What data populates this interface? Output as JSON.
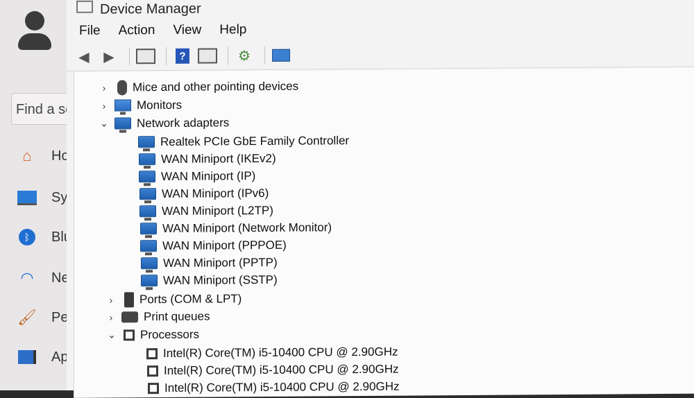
{
  "settings": {
    "search_placeholder": "Find a se",
    "nav": [
      {
        "label": "Ho",
        "icon": "home-icon"
      },
      {
        "label": "Sys",
        "icon": "system-icon"
      },
      {
        "label": "Blu",
        "icon": "bluetooth-icon"
      },
      {
        "label": "Ne",
        "icon": "wifi-icon"
      },
      {
        "label": "Per",
        "icon": "brush-icon"
      },
      {
        "label": "Ap",
        "icon": "apps-icon"
      }
    ]
  },
  "window": {
    "title": "Device Manager"
  },
  "menu": [
    "File",
    "Action",
    "View",
    "Help"
  ],
  "toolbar": [
    "back-icon",
    "forward-icon",
    "properties-icon",
    "help-icon",
    "view-icon",
    "update-driver-icon",
    "scan-hardware-icon"
  ],
  "tree": [
    {
      "label": "Mice and other pointing devices",
      "level": 0,
      "state": "collapsed",
      "icon": "mouse-icon"
    },
    {
      "label": "Monitors",
      "level": 0,
      "state": "collapsed",
      "icon": "monitor-icon"
    },
    {
      "label": "Network adapters",
      "level": 0,
      "state": "expanded",
      "icon": "network-adapter-icon"
    },
    {
      "label": "Realtek PCIe GbE Family Controller",
      "level": 1,
      "icon": "network-adapter-icon"
    },
    {
      "label": "WAN Miniport (IKEv2)",
      "level": 1,
      "icon": "network-adapter-icon"
    },
    {
      "label": "WAN Miniport (IP)",
      "level": 1,
      "icon": "network-adapter-icon"
    },
    {
      "label": "WAN Miniport (IPv6)",
      "level": 1,
      "icon": "network-adapter-icon"
    },
    {
      "label": "WAN Miniport (L2TP)",
      "level": 1,
      "icon": "network-adapter-icon"
    },
    {
      "label": "WAN Miniport (Network Monitor)",
      "level": 1,
      "icon": "network-adapter-icon"
    },
    {
      "label": "WAN Miniport (PPPOE)",
      "level": 1,
      "icon": "network-adapter-icon"
    },
    {
      "label": "WAN Miniport (PPTP)",
      "level": 1,
      "icon": "network-adapter-icon"
    },
    {
      "label": "WAN Miniport (SSTP)",
      "level": 1,
      "icon": "network-adapter-icon"
    },
    {
      "label": "Ports (COM & LPT)",
      "level": 0,
      "state": "collapsed",
      "icon": "port-icon"
    },
    {
      "label": "Print queues",
      "level": 0,
      "state": "collapsed",
      "icon": "printer-icon"
    },
    {
      "label": "Processors",
      "level": 0,
      "state": "expanded",
      "icon": "processor-icon"
    },
    {
      "label": "Intel(R) Core(TM) i5-10400 CPU @ 2.90GHz",
      "level": 1,
      "icon": "processor-icon"
    },
    {
      "label": "Intel(R) Core(TM) i5-10400 CPU @ 2.90GHz",
      "level": 1,
      "icon": "processor-icon"
    },
    {
      "label": "Intel(R) Core(TM) i5-10400 CPU @ 2.90GHz",
      "level": 1,
      "icon": "processor-icon"
    }
  ]
}
